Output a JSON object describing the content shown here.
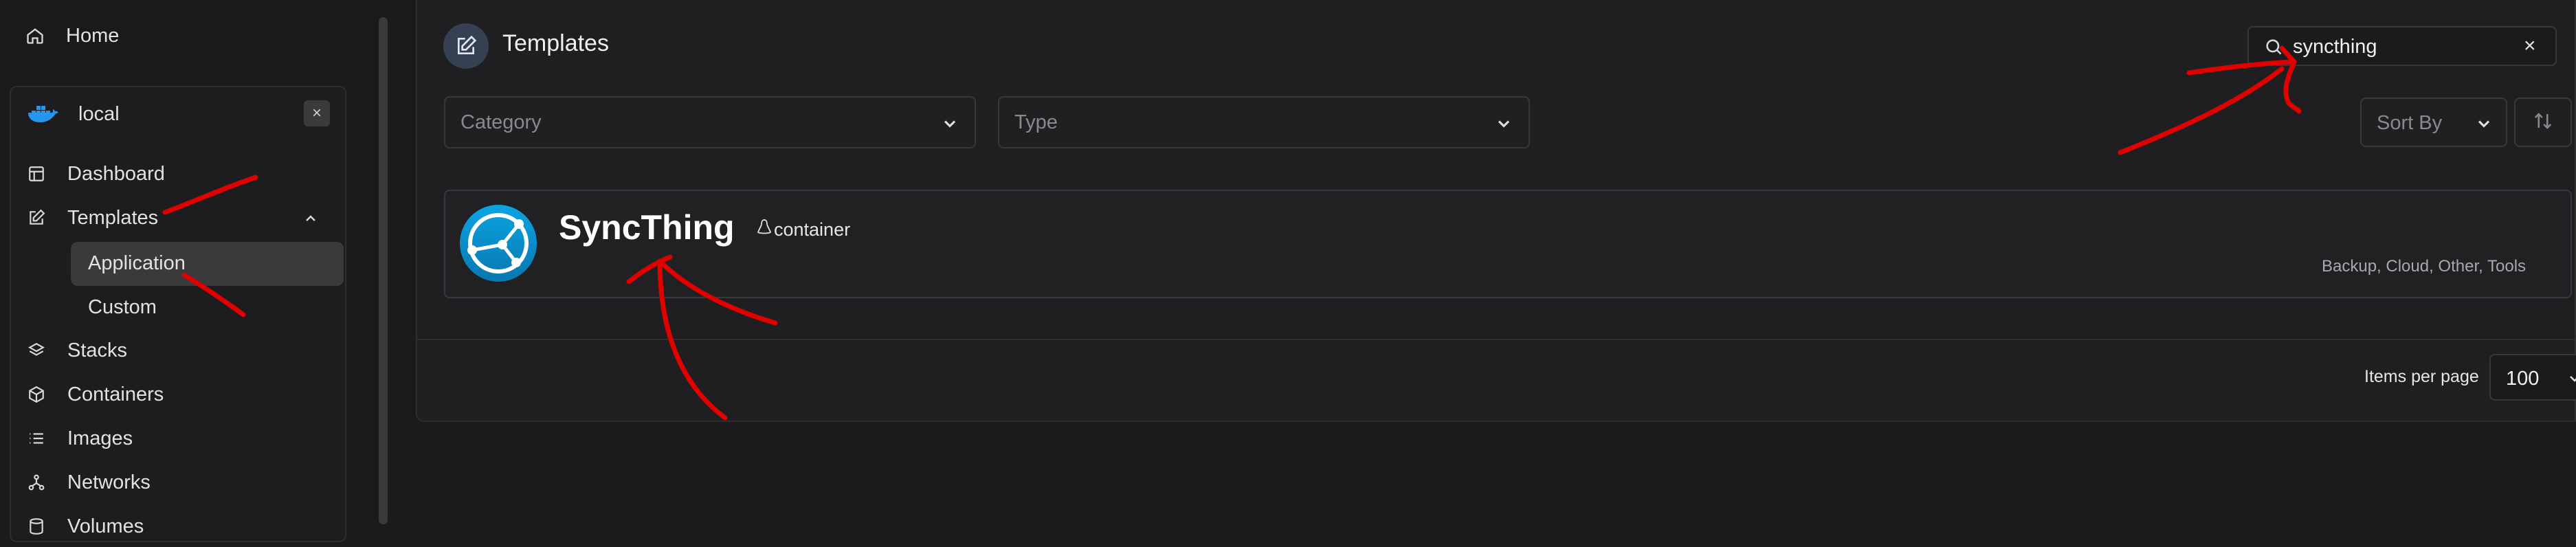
{
  "sidebar": {
    "home": "Home",
    "environment": {
      "name": "local",
      "close": "×"
    },
    "items": [
      {
        "label": "Dashboard"
      },
      {
        "label": "Templates"
      },
      {
        "label": "Application"
      },
      {
        "label": "Custom"
      },
      {
        "label": "Stacks"
      },
      {
        "label": "Containers"
      },
      {
        "label": "Images"
      },
      {
        "label": "Networks"
      },
      {
        "label": "Volumes"
      }
    ]
  },
  "header": {
    "title": "Templates",
    "search": {
      "value": "syncthing",
      "clear": "×"
    }
  },
  "filters": {
    "category_placeholder": "Category",
    "type_placeholder": "Type",
    "sort_placeholder": "Sort By"
  },
  "templates": [
    {
      "name": "SyncThing",
      "type": "container",
      "categories": "Backup, Cloud, Other, Tools"
    }
  ],
  "pagination": {
    "items_per_page_label": "Items per page",
    "items_per_page_value": "100"
  },
  "colors": {
    "background": "#1b1b1d",
    "card": "#1f1f21",
    "accent_blue": "#2496ed",
    "syncthing_blue": "#0891d1",
    "annotation_red": "#e00000"
  }
}
